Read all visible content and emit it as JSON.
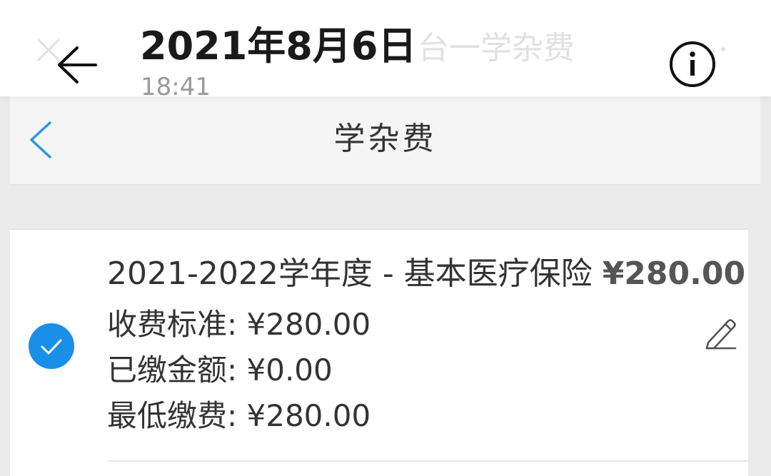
{
  "viewer": {
    "date": "2021年8月6日",
    "time": "18:41",
    "back_icon": "arrow-left-icon",
    "info_icon": "info-icon"
  },
  "background_page": {
    "close_icon": "close-icon",
    "title_fragment": "台一学杂费"
  },
  "header": {
    "title": "学杂费",
    "back_icon": "chevron-left-icon"
  },
  "fee_item": {
    "selected": true,
    "title": "2021-2022学年度 - 基本医疗保险",
    "amount": "¥280.00",
    "edit_icon": "pencil-icon",
    "rows": [
      {
        "label": "收费标准: ",
        "value": "¥280.00"
      },
      {
        "label": "已缴金额: ",
        "value": "¥0.00"
      },
      {
        "label": "最低缴费: ",
        "value": "¥280.00"
      }
    ]
  },
  "colors": {
    "accent_blue": "#1a8fe8",
    "chevron_blue": "#2a98dc",
    "text": "#333333",
    "muted": "#9a9a9a"
  }
}
